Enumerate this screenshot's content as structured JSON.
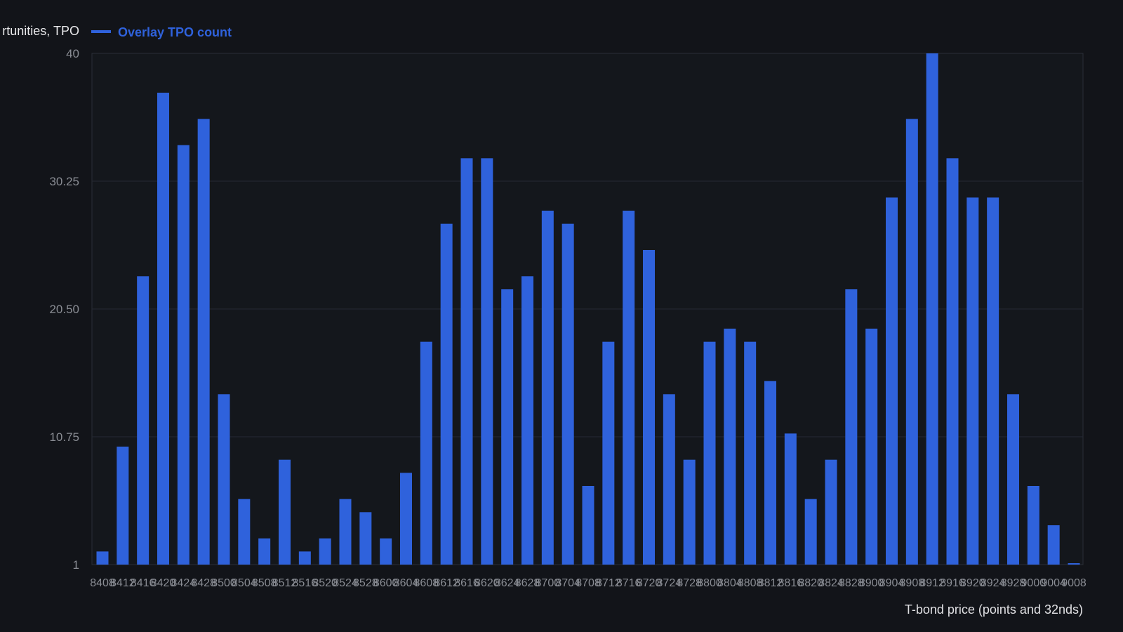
{
  "chart_data": {
    "type": "bar",
    "legend": {
      "placement": "top-left",
      "entries": [
        {
          "label": "rtunities, TPO",
          "color": "#e8e8ea",
          "marker": "none"
        },
        {
          "label": "Overlay TPO count",
          "color": "#2f62dc",
          "marker": "line"
        }
      ]
    },
    "xlabel": "T-bond price (points and 32nds)",
    "ylabel": "",
    "ylim": [
      1,
      40
    ],
    "yticks": [
      1,
      10.75,
      20.5,
      30.25,
      40
    ],
    "ytick_labels": [
      "1",
      "10.75",
      "20.50",
      "30.25",
      "40"
    ],
    "grid": true,
    "bar_color": "#2f62dc",
    "categories": [
      "8408",
      "8412",
      "8416",
      "8420",
      "8424",
      "8428",
      "8500",
      "8504",
      "8508",
      "8512",
      "8516",
      "8520",
      "8524",
      "8528",
      "8600",
      "8604",
      "8608",
      "8612",
      "8616",
      "8620",
      "8624",
      "8628",
      "8700",
      "8704",
      "8708",
      "8712",
      "8716",
      "8720",
      "8724",
      "8728",
      "8800",
      "8804",
      "8808",
      "8812",
      "8816",
      "8820",
      "8824",
      "8828",
      "8900",
      "8904",
      "8908",
      "8912",
      "8916",
      "8920",
      "8924",
      "8928",
      "9000",
      "9004",
      "9008"
    ],
    "values": [
      2,
      10,
      23,
      37,
      33,
      35,
      14,
      6,
      3,
      9,
      2,
      3,
      6,
      5,
      3,
      8,
      18,
      27,
      32,
      32,
      22,
      23,
      28,
      27,
      7,
      18,
      28,
      25,
      14,
      9,
      18,
      19,
      18,
      15,
      11,
      6,
      9,
      22,
      19,
      29,
      35,
      40,
      32,
      29,
      29,
      14,
      7,
      4,
      1
    ]
  }
}
